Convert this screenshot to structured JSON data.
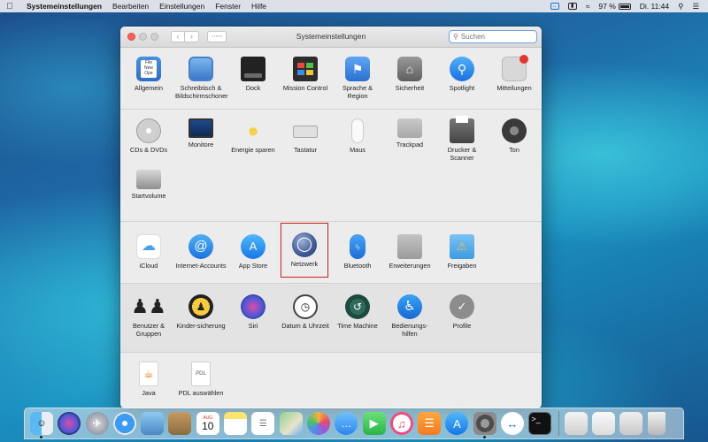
{
  "menubar": {
    "app": "Systemeinstellungen",
    "menus": [
      "Bearbeiten",
      "Einstellungen",
      "Fenster",
      "Hilfe"
    ],
    "battery": "97 %",
    "clock": "Di. 11:44"
  },
  "window": {
    "title": "Systemeinstellungen",
    "search_placeholder": "Suchen"
  },
  "sections": [
    [
      {
        "label": "Allgemein",
        "icon": "general-icon"
      },
      {
        "label": "Schreibtisch & Bildschirmschoner",
        "icon": "desktop-icon"
      },
      {
        "label": "Dock",
        "icon": "dock-icon"
      },
      {
        "label": "Mission Control",
        "icon": "mission-control-icon"
      },
      {
        "label": "Sprache & Region",
        "icon": "flag-icon"
      },
      {
        "label": "Sicherheit",
        "icon": "house-lock-icon"
      },
      {
        "label": "Spotlight",
        "icon": "magnifier-icon"
      },
      {
        "label": "Mitteilungen",
        "icon": "notifications-icon"
      }
    ],
    [
      {
        "label": "CDs & DVDs",
        "icon": "disc-icon"
      },
      {
        "label": "Monitore",
        "icon": "monitor-icon"
      },
      {
        "label": "Energie sparen",
        "icon": "bulb-icon"
      },
      {
        "label": "Tastatur",
        "icon": "keyboard-icon"
      },
      {
        "label": "Maus",
        "icon": "mouse-icon"
      },
      {
        "label": "Trackpad",
        "icon": "trackpad-icon"
      },
      {
        "label": "Drucker & Scanner",
        "icon": "printer-icon"
      },
      {
        "label": "Ton",
        "icon": "speaker-icon"
      },
      {
        "label": "Startvolume",
        "icon": "harddrive-icon"
      }
    ],
    [
      {
        "label": "iCloud",
        "icon": "cloud-icon"
      },
      {
        "label": "Internet-Accounts",
        "icon": "at-icon"
      },
      {
        "label": "App Store",
        "icon": "appstore-icon"
      },
      {
        "label": "Netzwerk",
        "icon": "globe-icon"
      },
      {
        "label": "Bluetooth",
        "icon": "bluetooth-icon"
      },
      {
        "label": "Erweiterungen",
        "icon": "puzzle-icon"
      },
      {
        "label": "Freigaben",
        "icon": "folder-warning-icon"
      }
    ],
    [
      {
        "label": "Benutzer & Gruppen",
        "icon": "users-icon"
      },
      {
        "label": "Kinder-sicherung",
        "icon": "parental-icon"
      },
      {
        "label": "Siri",
        "icon": "siri-icon"
      },
      {
        "label": "Datum & Uhrzeit",
        "icon": "clock-icon"
      },
      {
        "label": "Time Machine",
        "icon": "timemachine-icon"
      },
      {
        "label": "Bedienungs-hilfen",
        "icon": "accessibility-icon"
      },
      {
        "label": "Profile",
        "icon": "badge-check-icon"
      }
    ],
    [
      {
        "label": "Java",
        "icon": "java-icon"
      },
      {
        "label": "PDL auswählen",
        "icon": "pdl-document-icon"
      }
    ]
  ],
  "dock": {
    "calendar_month": "AUG",
    "calendar_day": "10"
  }
}
